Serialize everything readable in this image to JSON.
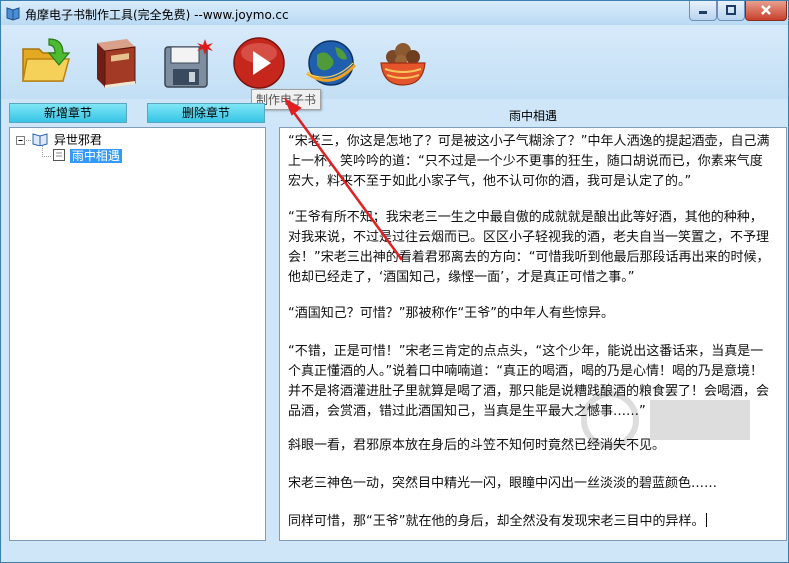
{
  "window": {
    "title": "角摩电子书制作工具(完全免费) --www.joymo.cc"
  },
  "toolbar": {
    "tooltip": "制作电子书",
    "icons": [
      "open-folder-icon",
      "book-icon",
      "save-icon",
      "play-icon",
      "globe-icon",
      "food-bowl-icon"
    ]
  },
  "chapters": {
    "add_label": "新增章节",
    "delete_label": "删除章节"
  },
  "tree": {
    "root": "异世邪君",
    "child": "雨中相遇"
  },
  "content": {
    "title": "雨中相遇",
    "paragraphs": [
      "“宋老三，你这是怎地了？可是被这小子气糊涂了？”中年人洒逸的提起酒壶，自己满上一杯，笑吟吟的道：“只不过是一个少不更事的狂生，随口胡说而已，你素来气度宏大，料来不至于如此小家子气，他不认可你的酒，我可是认定了的。”",
      "“王爷有所不知；我宋老三一生之中最自傲的成就就是酿出此等好酒，其他的种种，对我来说，不过是过往云烟而已。区区小子轻视我的酒，老夫自当一笑置之，不予理会！”宋老三出神的看着君邪离去的方向：“可惜我听到他最后那段话再出来的时候，他却已经走了，‘酒国知己，缘悭一面’，才是真正可惜之事。”",
      "“酒国知己？可惜？”那被称作“王爷”的中年人有些惊异。",
      "“不错，正是可惜！”宋老三肯定的点点头，“这个少年，能说出这番话来，当真是一个真正懂酒的人。”说着口中喃喃道：“真正的喝酒，喝的乃是心情！喝的乃是意境！并不是将酒灌进肚子里就算是喝了酒，那只能是说糟践酿酒的粮食罢了！会喝酒，会品酒，会赏酒，错过此酒国知己，当真是生平最大之憾事……”",
      "斜眼一看，君邪原本放在身后的斗笠不知何时竟然已经消失不见。",
      "宋老三神色一动，突然目中精光一闪，眼瞳中闪出一丝淡淡的碧蓝颜色……",
      "同样可惜，那“王爷”就在他的身后，却全然没有发现宋老三目中的异样。"
    ]
  }
}
